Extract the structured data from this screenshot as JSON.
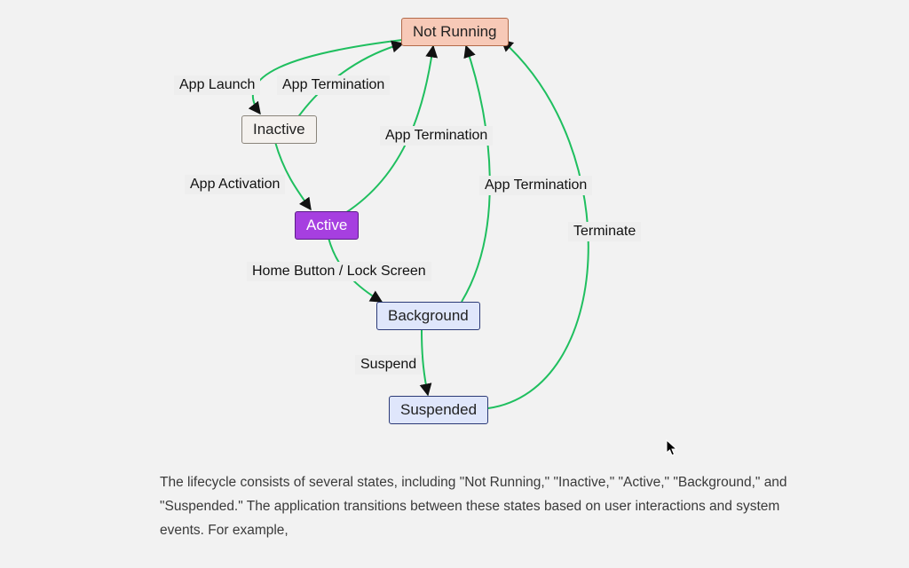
{
  "nodes": {
    "not_running": "Not Running",
    "inactive": "Inactive",
    "active": "Active",
    "background": "Background",
    "suspended": "Suspended"
  },
  "edges": {
    "app_launch": "App Launch",
    "app_termination_1": "App Termination",
    "app_activation": "App Activation",
    "app_termination_2": "App Termination",
    "home_lock": "Home Button / Lock Screen",
    "app_termination_3": "App Termination",
    "suspend": "Suspend",
    "terminate": "Terminate"
  },
  "caption": "The lifecycle consists of several states, including \"Not Running,\" \"Inactive,\" \"Active,\" \"Background,\" and \"Suspended.\" The application transitions between these states based on user interactions and system events. For example,",
  "colors": {
    "edge_stroke": "#1fbf5f"
  }
}
